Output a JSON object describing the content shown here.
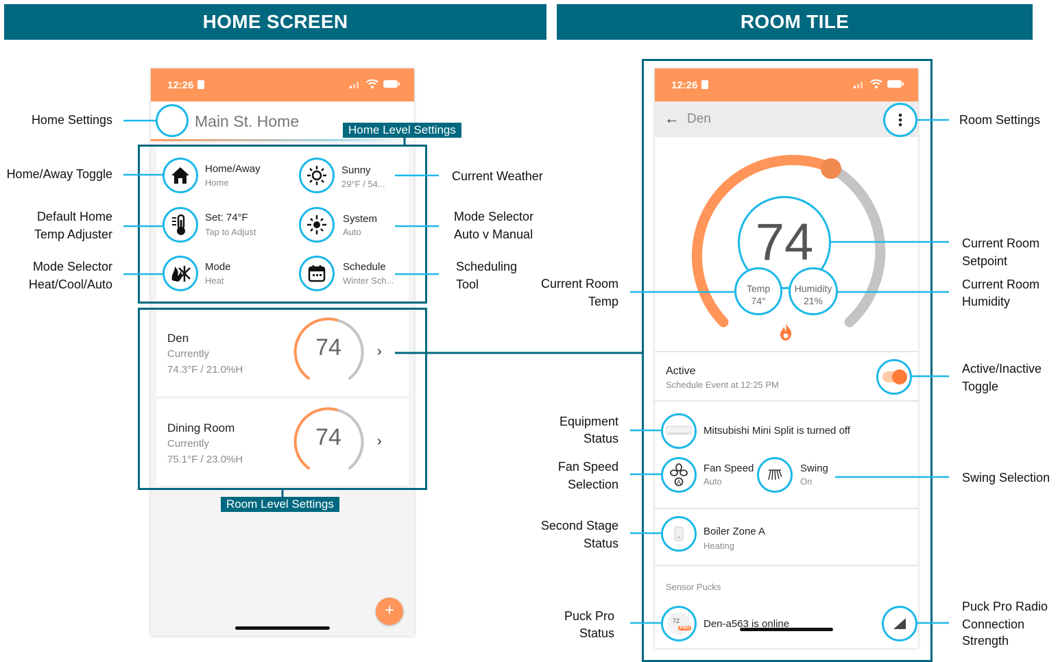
{
  "banners": {
    "home": "HOME SCREEN",
    "room": "ROOM TILE"
  },
  "home_phone": {
    "time": "12:26",
    "title": "Main St. Home",
    "tiles": [
      {
        "title": "Home/Away",
        "sub": "Home",
        "icon": "house-icon"
      },
      {
        "title": "Sunny",
        "sub": "29°F / 54...",
        "icon": "sun-icon"
      },
      {
        "title": "Set: 74°F",
        "sub": "Tap to Adjust",
        "icon": "thermometer-icon"
      },
      {
        "title": "System",
        "sub": "Auto",
        "icon": "system-auto-icon"
      },
      {
        "title": "Mode",
        "sub": "Heat",
        "icon": "heat-cool-icon"
      },
      {
        "title": "Schedule",
        "sub": "Winter Sch...",
        "icon": "calendar-icon"
      }
    ],
    "rooms": [
      {
        "name": "Den",
        "status": "Currently",
        "reading": "74.3°F / 21.0%H",
        "setpoint": "74"
      },
      {
        "name": "Dining Room",
        "status": "Currently",
        "reading": "75.1°F / 23.0%H",
        "setpoint": "74"
      }
    ],
    "home_level_tag": "Home Level Settings",
    "room_level_tag": "Room Level Settings",
    "fab": "+"
  },
  "room_phone": {
    "time": "12:26",
    "title": "Den",
    "setpoint": "74",
    "temp_label": "Temp",
    "temp_value": "74°",
    "humidity_label": "Humidity",
    "humidity_value": "21%",
    "active_title": "Active",
    "active_sub": "Schedule Event at 12:25 PM",
    "equipment": "Mitsubishi Mini Split is turned off",
    "fan_title": "Fan Speed",
    "fan_sub": "Auto",
    "swing_title": "Swing",
    "swing_sub": "On",
    "boiler_title": "Boiler Zone A",
    "boiler_sub": "Heating",
    "sensor_header": "Sensor Pucks",
    "puck": "Den-a563 is online",
    "puck_badge_temp": "72",
    "puck_badge_pro": "PRO"
  },
  "left_labels": {
    "home_settings": "Home Settings",
    "home_away": "Home/Away Toggle",
    "default_temp_1": "Default Home",
    "default_temp_2": "Temp Adjuster",
    "mode_sel_1": "Mode Selector",
    "mode_sel_2": "Heat/Cool/Auto",
    "weather": "Current Weather",
    "mode_auto_1": "Mode Selector",
    "mode_auto_2": "Auto v Manual",
    "sched_1": "Scheduling",
    "sched_2": "Tool"
  },
  "right_labels": {
    "room_temp_1": "Current Room",
    "room_temp_2": "Temp",
    "equip_1": "Equipment",
    "equip_2": "Status",
    "fan_1": "Fan Speed",
    "fan_2": "Selection",
    "second_1": "Second Stage",
    "second_2": "Status",
    "puck_1": "Puck Pro",
    "puck_2": "Status",
    "room_settings": "Room Settings",
    "setpoint_1": "Current Room",
    "setpoint_2": "Setpoint",
    "humidity_1": "Current Room",
    "humidity_2": "Humidity",
    "active_1": "Active/Inactive",
    "active_2": "Toggle",
    "swing": "Swing Selection",
    "radio_1": "Puck Pro Radio",
    "radio_2": "Connection",
    "radio_3": "Strength"
  },
  "colors": {
    "teal": "#00687f",
    "orange": "#ff9558",
    "cyan": "#1cb8e8",
    "gray": "#c4c4c4"
  }
}
